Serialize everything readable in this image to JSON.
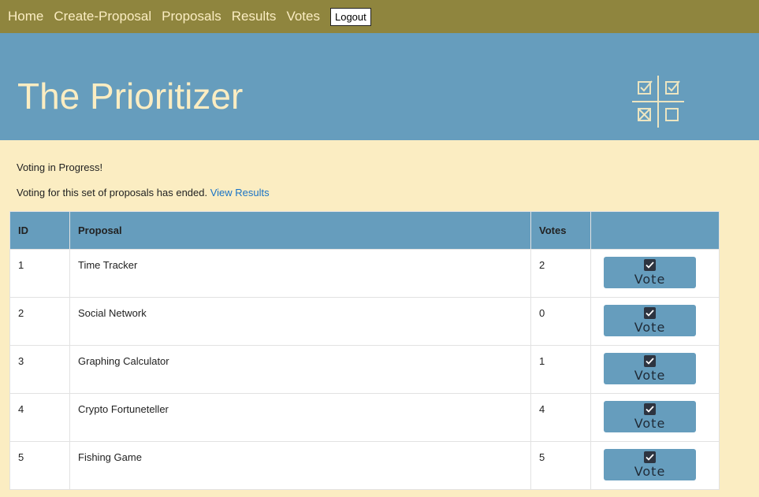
{
  "nav": {
    "home": "Home",
    "create": "Create-Proposal",
    "proposals": "Proposals",
    "results": "Results",
    "votes": "Votes",
    "logout": "Logout"
  },
  "hero": {
    "title": "The Prioritizer"
  },
  "messages": {
    "status": "Voting in Progress!",
    "ended": "Voting for this set of proposals has ended.",
    "view_results": "View Results"
  },
  "table": {
    "headers": {
      "id": "ID",
      "proposal": "Proposal",
      "votes": "Votes"
    },
    "vote_label": "Vote",
    "rows": [
      {
        "id": "1",
        "proposal": "Time Tracker",
        "votes": "2"
      },
      {
        "id": "2",
        "proposal": "Social Network",
        "votes": "0"
      },
      {
        "id": "3",
        "proposal": "Graphing Calculator",
        "votes": "1"
      },
      {
        "id": "4",
        "proposal": "Crypto Fortuneteller",
        "votes": "4"
      },
      {
        "id": "5",
        "proposal": "Fishing Game",
        "votes": "5"
      }
    ]
  },
  "colors": {
    "nav_bg": "#8f853e",
    "hero_bg": "#669dbd",
    "page_bg": "#fbedc2",
    "link": "#1a73c6"
  },
  "icons": {
    "logo": "checkbox-grid-icon",
    "vote": "check-square-icon"
  }
}
